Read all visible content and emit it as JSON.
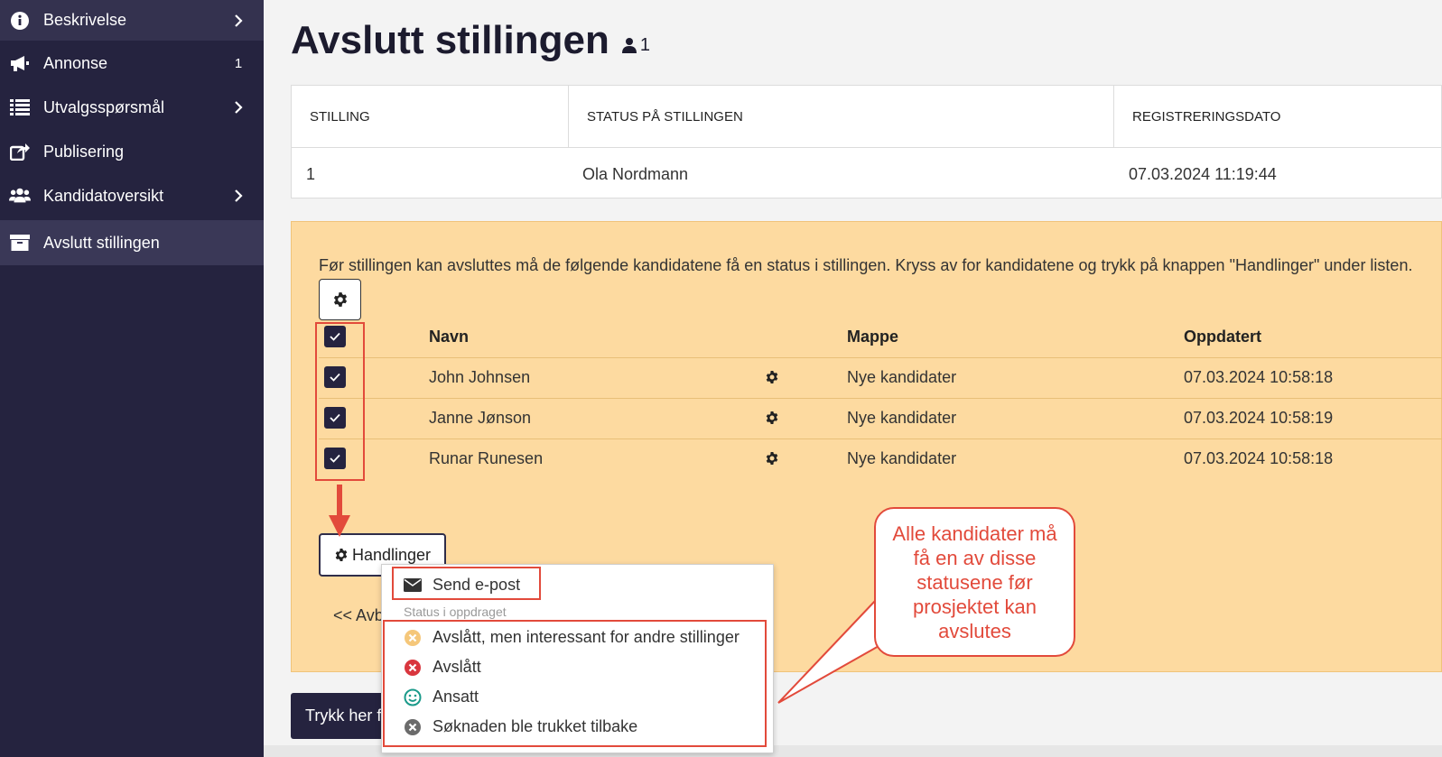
{
  "sidebar": {
    "items": [
      {
        "label": "Beskrivelse",
        "icon": "info-icon",
        "right": "chevron"
      },
      {
        "label": "Annonse",
        "icon": "megaphone-icon",
        "right": "1"
      },
      {
        "label": "Utvalgsspørsmål",
        "icon": "list-icon",
        "right": "chevron"
      },
      {
        "label": "Publisering",
        "icon": "share-icon",
        "right": ""
      },
      {
        "label": "Kandidatoversikt",
        "icon": "users-icon",
        "right": "chevron"
      },
      {
        "label": "Avslutt stillingen",
        "icon": "archive-icon",
        "right": ""
      }
    ],
    "active_index": 5
  },
  "page": {
    "title": "Avslutt stillingen",
    "person_count": "1"
  },
  "position_table": {
    "headers": [
      "STILLING",
      "STATUS PÅ STILLINGEN",
      "REGISTRERINGSDATO"
    ],
    "row": [
      "1",
      "Ola Nordmann",
      "07.03.2024 11:19:44"
    ]
  },
  "candidates_panel": {
    "intro": "Før stillingen kan avsluttes må de følgende kandidatene få en status i stillingen. Kryss av for kandidatene og trykk på knappen \"Handlinger\" under listen.",
    "headers": {
      "name": "Navn",
      "folder": "Mappe",
      "updated": "Oppdatert"
    },
    "rows": [
      {
        "name": "John Johnsen",
        "folder": "Nye kandidater",
        "updated": "07.03.2024 10:58:18",
        "checked": true
      },
      {
        "name": "Janne Jønson",
        "folder": "Nye kandidater",
        "updated": "07.03.2024 10:58:19",
        "checked": true
      },
      {
        "name": "Runar Runesen",
        "folder": "Nye kandidater",
        "updated": "07.03.2024 10:58:18",
        "checked": true
      }
    ],
    "actions_button": "Handlinger",
    "back_link": "<< Avb"
  },
  "submit_button": "Trykk her f",
  "dropdown": {
    "send_email": "Send e-post",
    "status_header": "Status i oppdraget",
    "statuses": [
      {
        "label": "Avslått, men interessant for andre stillinger",
        "icon": "times-circle-icon",
        "color": "#f5b84f"
      },
      {
        "label": "Avslått",
        "icon": "times-circle-icon",
        "color": "#d9363e"
      },
      {
        "label": "Ansatt",
        "icon": "smile-icon",
        "color": "#1a9a8a"
      },
      {
        "label": "Søknaden ble trukket tilbake",
        "icon": "times-circle-icon",
        "color": "#6b6b6b"
      }
    ]
  },
  "callout": {
    "text": "Alle kandidater må få en av disse statusene før prosjektet kan avslutes"
  },
  "colors": {
    "sidebar_bg": "#25233f",
    "panel_bg": "#fddaa0",
    "annotation_red": "#e24a3b"
  }
}
